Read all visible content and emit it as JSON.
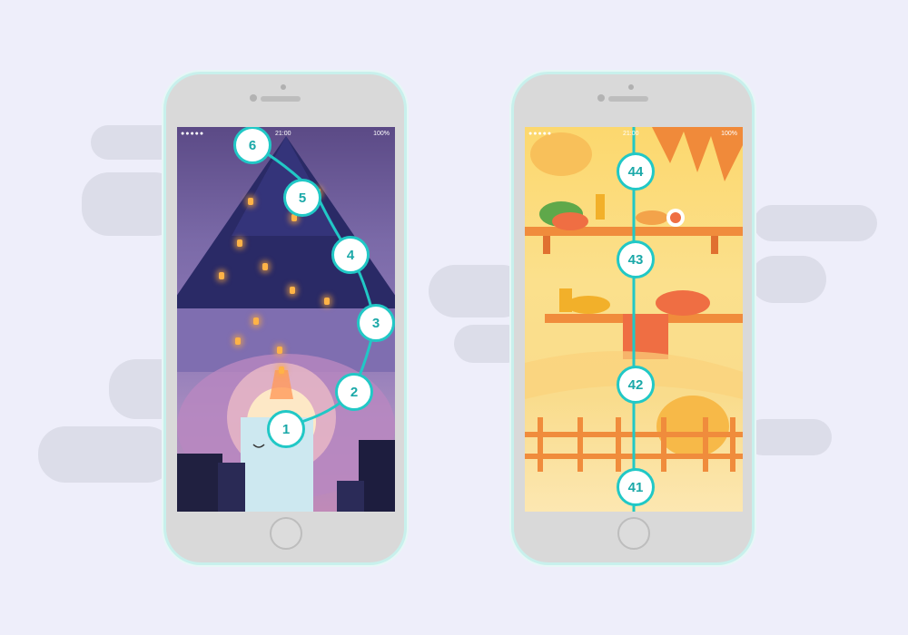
{
  "left_phone": {
    "status": {
      "signal": "●●●●● ",
      "time": "21:00",
      "battery": "100%"
    },
    "levels": [
      "1",
      "2",
      "3",
      "4",
      "5",
      "6"
    ]
  },
  "right_phone": {
    "status": {
      "signal": "●●●●● ",
      "time": "21:00",
      "battery": "100%"
    },
    "levels": [
      "41",
      "42",
      "43",
      "44"
    ]
  },
  "colors": {
    "accent": "#21c8c6",
    "background": "#eeeefa"
  }
}
